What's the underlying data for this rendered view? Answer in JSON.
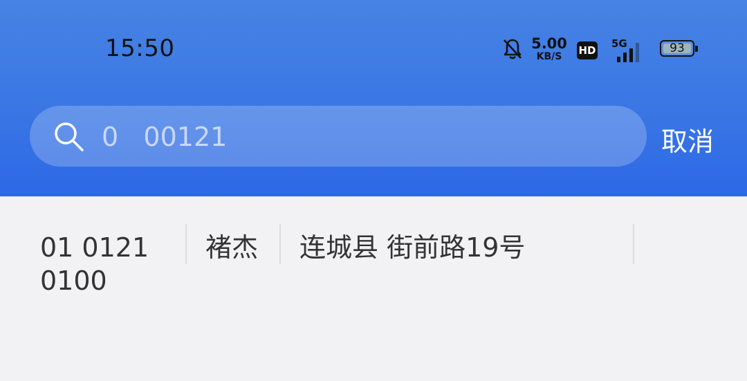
{
  "status_bar": {
    "time": "15:50",
    "net_speed_value": "5.00",
    "net_speed_unit": "KB/S",
    "hd_label": "HD",
    "network_type": "5G",
    "battery_percent": "93",
    "icons": [
      "bell-muted-icon",
      "hd-icon",
      "signal-5g-icon",
      "battery-icon"
    ]
  },
  "search": {
    "query": "0   00121",
    "cancel_label": "取消"
  },
  "result": {
    "phone_line1": "01  0121",
    "phone_line2": "0100",
    "name": "褚杰",
    "address": "连城县            街前路19号"
  },
  "colors": {
    "header_top": "#4783e3",
    "header_bottom": "#2d68e6",
    "page_background": "#f2f2f4",
    "text_primary": "#333333"
  }
}
